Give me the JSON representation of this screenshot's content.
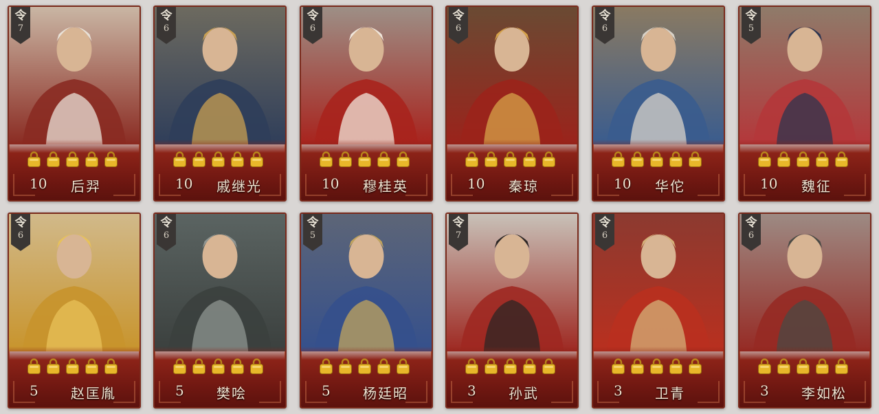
{
  "colors": {
    "card_border": "#7a2a1c",
    "card_bottom": "#8c2318",
    "badge_bg": "#3a3634",
    "star_gold": "#e8b72a",
    "text_light": "#f0e3d0"
  },
  "badge_char": "令",
  "cards": [
    {
      "name": "后羿",
      "level": "10",
      "cost": "7",
      "stars": 5,
      "palette": [
        "#c9b6a4",
        "#8a2b22",
        "#e9e2d8"
      ]
    },
    {
      "name": "戚继光",
      "level": "10",
      "cost": "6",
      "stars": 5,
      "palette": [
        "#6d6a5f",
        "#2f3e5a",
        "#c9a052"
      ]
    },
    {
      "name": "穆桂英",
      "level": "10",
      "cost": "6",
      "stars": 5,
      "palette": [
        "#9d8f86",
        "#a8231d",
        "#f1e7db"
      ]
    },
    {
      "name": "秦琼",
      "level": "10",
      "cost": "6",
      "stars": 5,
      "palette": [
        "#6a4a33",
        "#9b231b",
        "#d6a34a"
      ]
    },
    {
      "name": "华佗",
      "level": "10",
      "cost": "6",
      "stars": 5,
      "palette": [
        "#8a7a62",
        "#3a5c8e",
        "#d9d3c9"
      ]
    },
    {
      "name": "魏征",
      "level": "10",
      "cost": "5",
      "stars": 5,
      "palette": [
        "#8f7b6a",
        "#b4373a",
        "#2c3550"
      ]
    },
    {
      "name": "赵匡胤",
      "level": "5",
      "cost": "6",
      "stars": 5,
      "palette": [
        "#d1b98a",
        "#c8942c",
        "#e8c25a"
      ]
    },
    {
      "name": "樊哙",
      "level": "5",
      "cost": "6",
      "stars": 5,
      "palette": [
        "#5b6462",
        "#3b403e",
        "#8f9592"
      ]
    },
    {
      "name": "杨廷昭",
      "level": "5",
      "cost": "5",
      "stars": 5,
      "palette": [
        "#5d6577",
        "#35508c",
        "#c2a45c"
      ]
    },
    {
      "name": "孙武",
      "level": "3",
      "cost": "7",
      "stars": 5,
      "palette": [
        "#c8c1b8",
        "#9e2821",
        "#2c2624"
      ]
    },
    {
      "name": "卫青",
      "level": "3",
      "cost": "6",
      "stars": 5,
      "palette": [
        "#8c3a30",
        "#b9301f",
        "#d4b27a"
      ]
    },
    {
      "name": "李如松",
      "level": "3",
      "cost": "6",
      "stars": 5,
      "palette": [
        "#9d8a83",
        "#962a24",
        "#4a4a44"
      ]
    }
  ]
}
